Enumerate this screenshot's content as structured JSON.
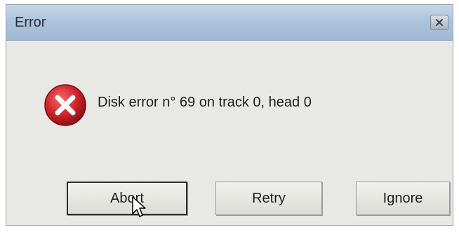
{
  "window": {
    "title": "Error",
    "close_icon": "close-icon"
  },
  "message": {
    "icon": "error-icon",
    "text": "Disk error n° 69 on track 0, head 0"
  },
  "buttons": {
    "abort_label": "Abort",
    "retry_label": "Retry",
    "ignore_label": "Ignore"
  },
  "colors": {
    "titlebar": "#aec4dd",
    "dialog_bg": "#e8e8e4",
    "error_red": "#d2232a"
  }
}
